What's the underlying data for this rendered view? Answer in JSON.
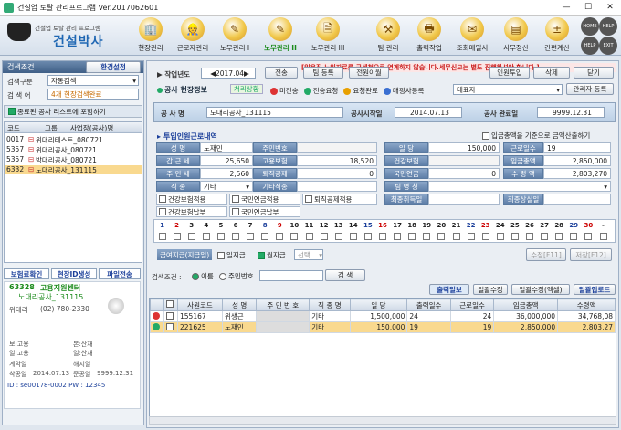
{
  "window": {
    "title": "건설업 토탈 관리프로그램 Ver.2017062601"
  },
  "logo": {
    "subtitle": "건설업 토탈 관리 프로그램",
    "name": "건설박사"
  },
  "toolbar": {
    "items": [
      "현장관리",
      "근로자관리",
      "노무관리 I",
      "노무관리 II",
      "노무관리 III",
      "팀 관리",
      "출력작업",
      "조회메일서",
      "사무정산",
      "간편계산"
    ],
    "active": "노무관리 II",
    "top_right": [
      "HOME",
      "HELP",
      "HELP",
      "EXIT"
    ]
  },
  "left": {
    "tab_search": "검색조건",
    "tab_settings": "환경설정",
    "search_type_label": "검색구분",
    "search_type_value": "자동검색",
    "search_word_label": "검 색 어",
    "search_word_value": "4개 현장검색완료",
    "include_closed": "종료된 공사 리스트에 포함하기",
    "col_code": "코드",
    "col_group": "그룹",
    "col_name": "사업장(공사)명",
    "rows": [
      {
        "code": "0017",
        "name": "위대리테스트_080721"
      },
      {
        "code": "5357",
        "name": "위대리공사_080721"
      },
      {
        "code": "5357",
        "name": "박대리공사_080721"
      },
      {
        "code": "6332",
        "name": "노대리공사_131115"
      }
    ],
    "btn_insurance": "보험료확인",
    "btn_id": "현장ID생성",
    "btn_file": "파일전송",
    "site_code": "63328",
    "site_center": "고용지원센터",
    "site_name": "노대리공사_131115",
    "phone_label": "위대리",
    "phone": "(02) 780-2330",
    "info": {
      "l1": "보:고용",
      "l2": "본:산재",
      "l3": "일:고용",
      "l4": "일:산재",
      "l5": "계약일",
      "l6": "해지일",
      "l7": "착공일",
      "l8": "2014.07.13",
      "l9": "준공일",
      "l10": "9999.12.31"
    },
    "id_label": "ID",
    "id_value": "se00178-0002",
    "pw_label": "PW",
    "pw_value": "12345"
  },
  "main": {
    "notice": "[일용직 노임자료를 국세청으로 연계하지 않습니다.세무신고는 별도 진행하셔야 합니다.]",
    "work_year_label": "작업년도",
    "work_year": "2017.04",
    "btn_all": "전송",
    "btn_team": "팀 등록",
    "btn_move": "전원이월",
    "btn_person": "인원투입",
    "btn_delete": "삭제",
    "btn_close": "닫기",
    "site_info_label": "공사 현장정보",
    "status_label": "처리상황",
    "status": [
      "미전송",
      "전송요청",
      "요청완료",
      "매핑사등록"
    ],
    "ceo_value": "대표자",
    "btn_manager": "관리자 등록",
    "site_name_label": "공 사 명",
    "site_name_value": "노대리공사_131115",
    "start_label": "공사시작일",
    "start_value": "2014.07.13",
    "end_label": "공사 완료일",
    "end_value": "9999.12.31",
    "worker_label": "투입인원근로내역",
    "checkbox_label": "입금총액을 기준으로 금액산출하기",
    "f": {
      "name_l": "성 명",
      "name_v": "노재민",
      "id_l": "주민번호",
      "wage_l": "일 당",
      "wage_v": "150,000",
      "days_l": "근로일수",
      "days_v": "19",
      "tax_l": "갑 근 세",
      "tax_v": "25,650",
      "emp_l": "고용보험",
      "emp_v": "18,520",
      "pay_l": "임금총액",
      "pay_v": "2,850,000",
      "res_l": "주 민 세",
      "res_v": "2,560",
      "ret_l": "퇴직공제",
      "ret_v": "0",
      "health_l": "건강보험",
      "health_v": "0",
      "pension_l": "국민연금",
      "pension_v": "0",
      "net_l": "수 령 액",
      "net_v": "2,803,270",
      "job_l": "직 종",
      "job_v": "기타",
      "skill_l": "기타직종",
      "team_l": "팀 명 칭",
      "c1": "건강보험적용",
      "c2": "국민연금적용",
      "c3": "퇴직공제적용",
      "c4": "건강보험납부",
      "c5": "국민연금납부",
      "join_l": "최종취득일",
      "lose_l": "최종상실일"
    },
    "days": [
      "1",
      "2",
      "3",
      "4",
      "5",
      "6",
      "7",
      "8",
      "9",
      "10",
      "11",
      "12",
      "13",
      "14",
      "15",
      "16",
      "17",
      "18",
      "19",
      "20",
      "21",
      "22",
      "23",
      "24",
      "25",
      "26",
      "27",
      "28",
      "29",
      "30",
      "-"
    ],
    "pay_method": "급여지급(지급일)",
    "chk_daily": "일지급",
    "chk_monthly": "월지급",
    "select": "선택",
    "btn_edit": "수정[F11]",
    "btn_save": "저장[F12]",
    "search_cond": "검색조건 :",
    "radio_name": "이름",
    "radio_id": "주민번호",
    "btn_search": "검 색",
    "btn_print": "출력일보",
    "btn_daily": "일괄수정",
    "btn_edit_batch": "일괄수정(엑셀)",
    "btn_upload": "일괄업로드",
    "cols": [
      "사원코드",
      "성 명",
      "주 민 번 호",
      "직 종 명",
      "일 당",
      "출력일수",
      "근로일수",
      "임금총액",
      "수령액"
    ],
    "rows": [
      {
        "code": "155167",
        "name": "위생근",
        "job": "기타",
        "wage": "1,500,000",
        "out": "24",
        "work": "24",
        "total": "36,000,000",
        "net": "34,768,08"
      },
      {
        "code": "221625",
        "name": "노재민",
        "job": "기타",
        "wage": "150,000",
        "out": "19",
        "work": "19",
        "total": "2,850,000",
        "net": "2,803,27"
      }
    ]
  }
}
